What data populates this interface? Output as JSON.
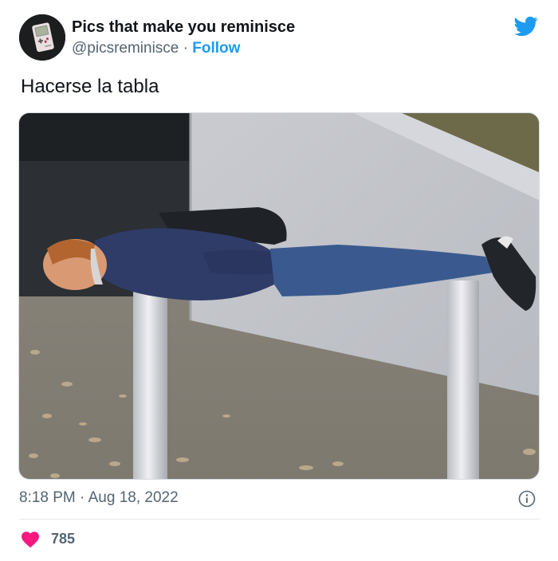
{
  "author": {
    "display_name": "Pics that make you reminisce",
    "handle": "@picsreminisce",
    "separator": "·",
    "follow_label": "Follow"
  },
  "tweet": {
    "text": "Hacerse la tabla",
    "time": "8:18 PM",
    "separator": "·",
    "date": "Aug 18, 2022",
    "likes": "785"
  },
  "icons": {
    "brand": "twitter-bird-icon",
    "info": "info-icon",
    "like": "heart-icon"
  },
  "colors": {
    "accent": "#1d9bf0",
    "like": "#f91880",
    "secondary_text": "#536471"
  }
}
